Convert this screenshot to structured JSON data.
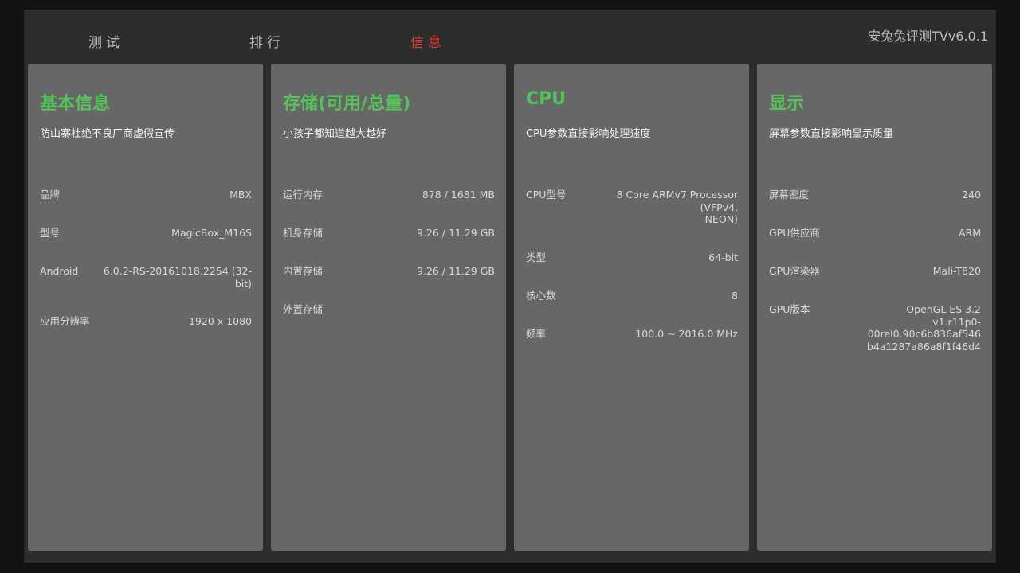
{
  "tabs": [
    {
      "label": "测试"
    },
    {
      "label": "排行"
    },
    {
      "label": "信息",
      "active": true
    }
  ],
  "app_title": "安兔兔评测TVv6.0.1",
  "colors": {
    "accent_green": "#53c35a",
    "active_tab": "#e53a2f",
    "card_bg": "#676767",
    "panel_bg": "#2d2d2d"
  },
  "cards": {
    "basic": {
      "title": "基本信息",
      "subtitle": "防山寨杜绝不良厂商虚假宣传",
      "rows": [
        {
          "label": "品牌",
          "value": "MBX"
        },
        {
          "label": "型号",
          "value": "MagicBox_M16S"
        },
        {
          "label": "Android",
          "value": "6.0.2-RS-20161018.2254 (32-bit)"
        },
        {
          "label": "应用分辨率",
          "value": "1920 x 1080"
        }
      ]
    },
    "storage": {
      "title": "存储(可用/总量)",
      "subtitle": "小孩子都知道越大越好",
      "rows": [
        {
          "label": "运行内存",
          "value": "878 / 1681 MB"
        },
        {
          "label": "机身存储",
          "value": "9.26 / 11.29 GB"
        },
        {
          "label": "内置存储",
          "value": "9.26 / 11.29 GB"
        },
        {
          "label": "外置存储",
          "value": ""
        }
      ]
    },
    "cpu": {
      "title": "CPU",
      "subtitle": "CPU参数直接影响处理速度",
      "rows": [
        {
          "label": "CPU型号",
          "value": "8 Core ARMv7 Processor (VFPv4,\nNEON)"
        },
        {
          "label": "类型",
          "value": "64-bit"
        },
        {
          "label": "核心数",
          "value": "8"
        },
        {
          "label": "频率",
          "value": "100.0 ~ 2016.0 MHz"
        }
      ]
    },
    "display": {
      "title": "显示",
      "subtitle": "屏幕参数直接影响显示质量",
      "rows": [
        {
          "label": "屏幕密度",
          "value": "240"
        },
        {
          "label": "GPU供应商",
          "value": "ARM"
        },
        {
          "label": "GPU渲染器",
          "value": "Mali-T820"
        },
        {
          "label": "GPU版本",
          "value": "OpenGL ES 3.2\nv1.r11p0-00rel0.90c6b836af546\nb4a1287a86a8f1f46d4"
        }
      ]
    }
  }
}
